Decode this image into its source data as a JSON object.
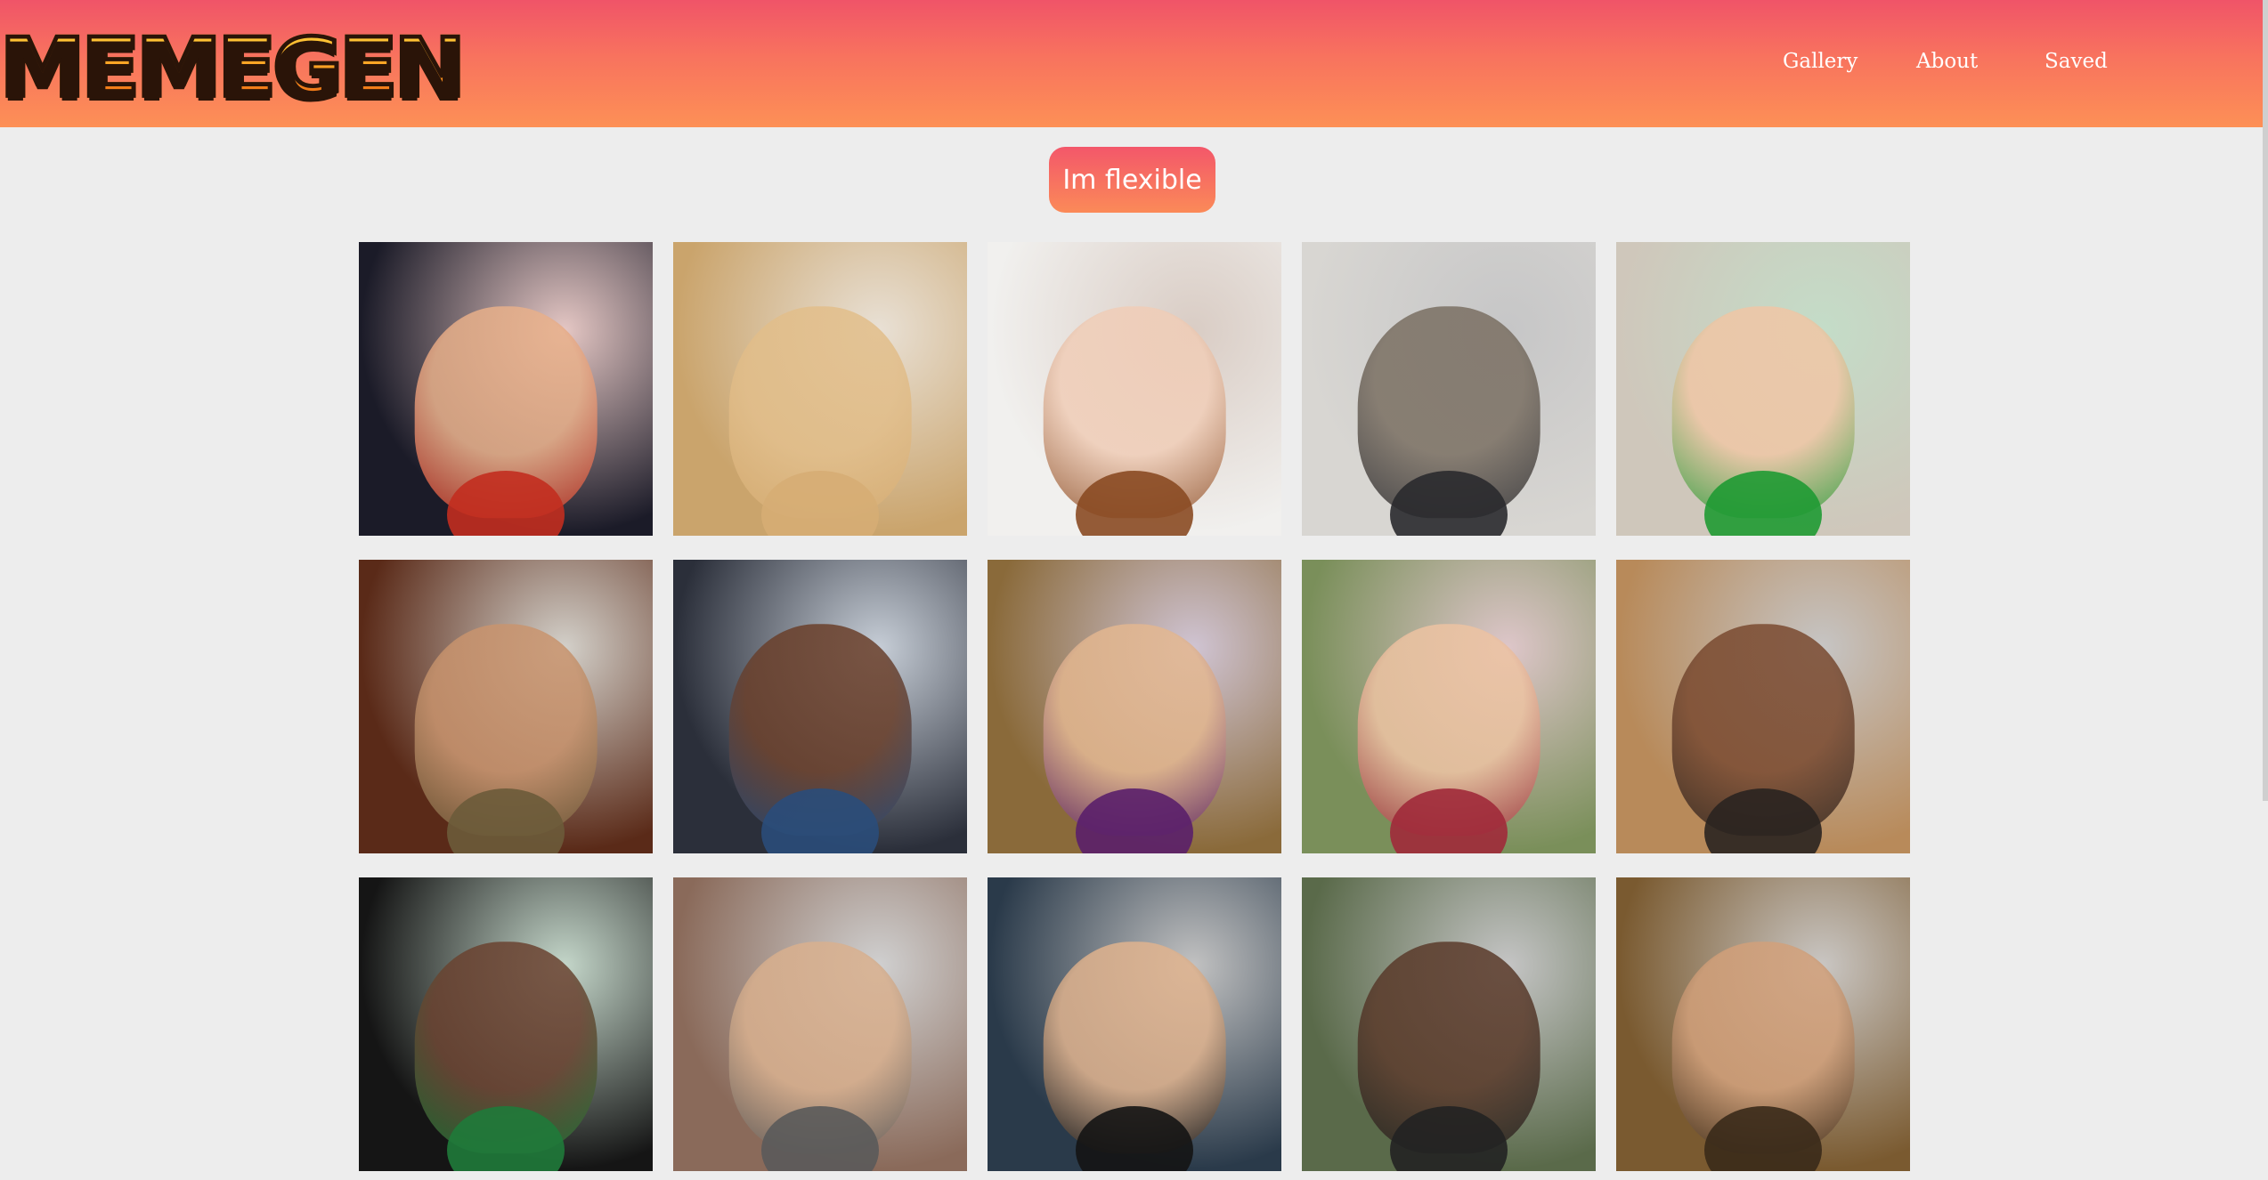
{
  "header": {
    "logo_text": "MEMEGEN",
    "nav": [
      {
        "label": "Gallery"
      },
      {
        "label": "About"
      },
      {
        "label": "Saved"
      }
    ]
  },
  "main": {
    "button_label": "Im flexible"
  },
  "gallery": {
    "images": [
      {
        "name": "meme-image-speaker-finger-up",
        "bg": "#1b1b28",
        "subject": "#e8b08a",
        "accent": "#c22d1f"
      },
      {
        "name": "meme-image-puppies-kissing",
        "bg": "#caa46c",
        "subject": "#e2be8a",
        "accent": "#d6ad74"
      },
      {
        "name": "meme-image-baby-and-puppy-sleeping",
        "bg": "#f1f0ee",
        "subject": "#f0cdb7",
        "accent": "#8a4a22"
      },
      {
        "name": "meme-image-cat-on-laptop",
        "bg": "#d8d6d2",
        "subject": "#7a6f62",
        "accent": "#2a2a2e"
      },
      {
        "name": "meme-image-success-kid",
        "bg": "#cfc7bb",
        "subject": "#f0c6a5",
        "accent": "#1f9a33"
      },
      {
        "name": "meme-image-aliens-guy",
        "bg": "#5a2a18",
        "subject": "#c9946e",
        "accent": "#6b5b3a"
      },
      {
        "name": "meme-image-surprised-baby",
        "bg": "#2b2f3a",
        "subject": "#6a3f2a",
        "accent": "#2a4d7a"
      },
      {
        "name": "meme-image-condescending-wonka",
        "bg": "#8a6a3a",
        "subject": "#e3b790",
        "accent": "#5a1f6a"
      },
      {
        "name": "meme-image-evil-toddler",
        "bg": "#7a8f5a",
        "subject": "#edc3a2",
        "accent": "#a02a3a"
      },
      {
        "name": "meme-image-laughing-man",
        "bg": "#b88a5a",
        "subject": "#7a4a30",
        "accent": "#2a2320"
      },
      {
        "name": "meme-image-athletes-embrace",
        "bg": "#151515",
        "subject": "#6a4230",
        "accent": "#1f7a3a"
      },
      {
        "name": "meme-image-man-pointing",
        "bg": "#8a6a5a",
        "subject": "#d9b08e",
        "accent": "#5a5a5a"
      },
      {
        "name": "meme-image-toast-raise",
        "bg": "#2a3a4a",
        "subject": "#e0b38e",
        "accent": "#141414"
      },
      {
        "name": "meme-image-sunglasses-man",
        "bg": "#5a6a4a",
        "subject": "#5a3a2a",
        "accent": "#222222"
      },
      {
        "name": "meme-image-one-does-not-simply",
        "bg": "#7a5a30",
        "subject": "#d2a07a",
        "accent": "#3a2a1a"
      }
    ]
  }
}
